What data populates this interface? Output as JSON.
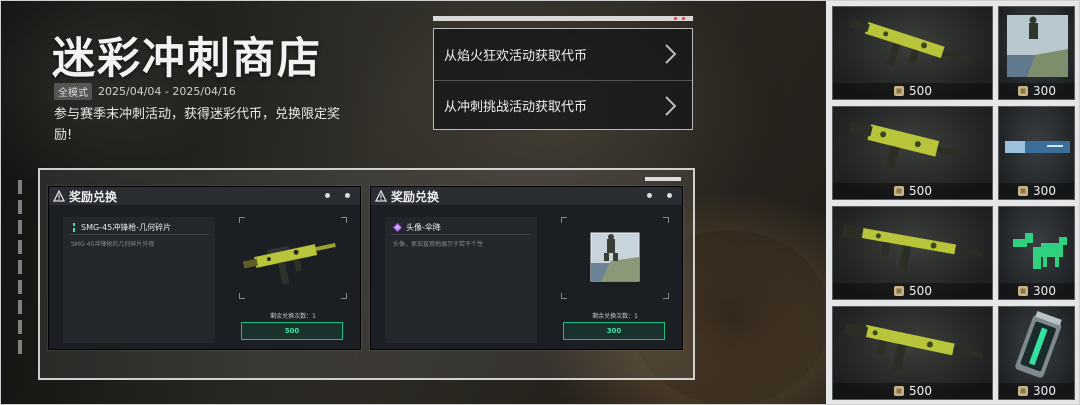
{
  "header": {
    "title": "迷彩冲刺商店",
    "mode_badge": "全模式",
    "date_range": "2025/04/04 - 2025/04/16",
    "description": "参与赛季末冲刺活动，获得迷彩代币，兑换限定奖励!"
  },
  "sources": {
    "items": [
      {
        "label": "从焰火狂欢活动获取代币"
      },
      {
        "label": "从冲刺挑战活动获取代币"
      }
    ]
  },
  "exchange": {
    "cards": [
      {
        "header": "奖励兑换",
        "item_name": "SMG-45冲锋枪-几何碎片",
        "item_desc": "SMG-45冲锋枪的几何碎片外观",
        "remaining": "剩余兑换次数：1",
        "price": "500",
        "icon": "gun-icon"
      },
      {
        "header": "奖励兑换",
        "item_name": "头像-伞降",
        "item_desc": "头像，更加直观地展示于若干个性",
        "remaining": "剩余兑换次数：1",
        "price": "300",
        "icon": "parachute-avatar-icon"
      }
    ]
  },
  "shop": {
    "rows": [
      {
        "big": {
          "price": "500",
          "icon": "smg-camo-icon"
        },
        "small": {
          "price": "300",
          "icon": "parachute-avatar-icon"
        }
      },
      {
        "big": {
          "price": "500",
          "icon": "pistol-smg-camo-icon"
        },
        "small": {
          "price": "300",
          "icon": "name-banner-icon"
        }
      },
      {
        "big": {
          "price": "500",
          "icon": "rifle-camo-icon"
        },
        "small": {
          "price": "300",
          "icon": "dino-spray-icon"
        }
      },
      {
        "big": {
          "price": "500",
          "icon": "assault-rifle-camo-icon"
        },
        "small": {
          "price": "300",
          "icon": "canister-icon"
        }
      }
    ]
  },
  "colors": {
    "accent_green": "#3fe4a2",
    "camo_yellow": "#b8c43a"
  }
}
